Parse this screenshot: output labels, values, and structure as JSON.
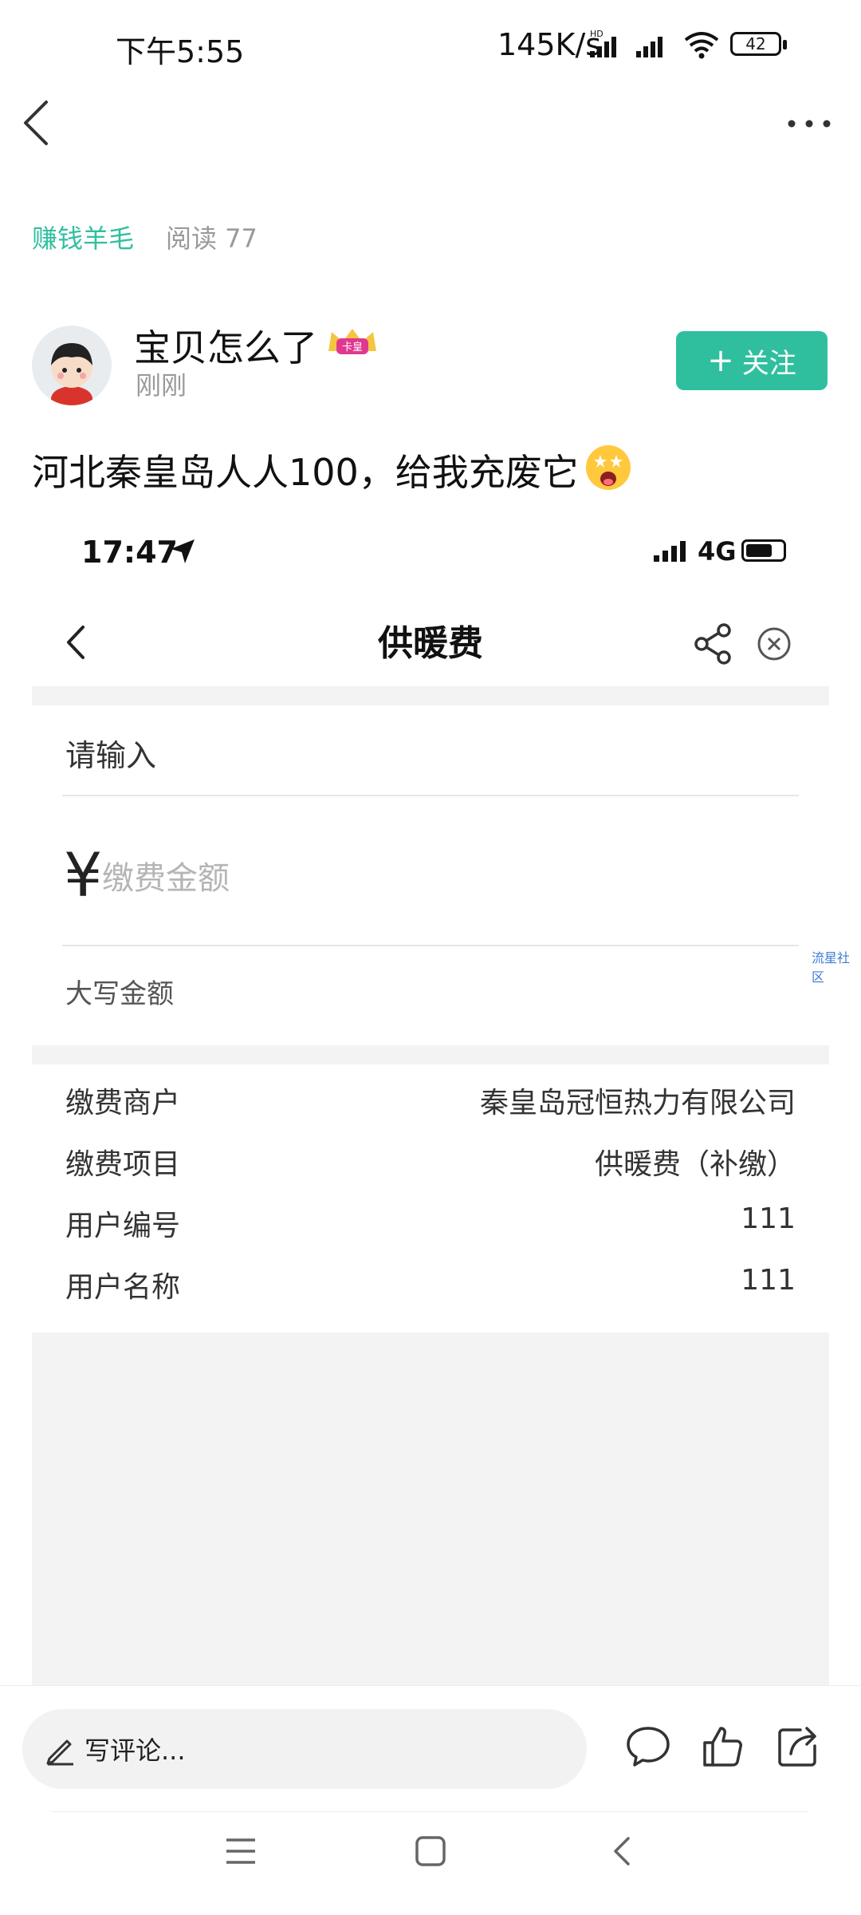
{
  "status_bar": {
    "time": "下午5:55",
    "net_speed": "145K/s",
    "battery": "42"
  },
  "header": {
    "icons": [
      "chevron-left-icon",
      "more-icon"
    ]
  },
  "tags": {
    "category": "赚钱羊毛",
    "reads": "阅读 77"
  },
  "author": {
    "name": "宝贝怎么了",
    "time": "刚刚",
    "badge": "卡皇",
    "follow_label": "关注",
    "follow_color": "#2fbf9f"
  },
  "post": {
    "text": "河北秦皇岛人人100，给我充废它"
  },
  "screenshot": {
    "time": "17:47",
    "network": "4G",
    "title": "供暖费",
    "input_placeholder": "请输入",
    "currency": "¥",
    "amount_placeholder": "缴费金额",
    "uppercase_label": "大写金额",
    "watermark": "流星社区",
    "rows": [
      {
        "label": "缴费商户",
        "value": "秦皇岛冠恒热力有限公司"
      },
      {
        "label": "缴费项目",
        "value": "供暖费（补缴）"
      },
      {
        "label": "用户编号",
        "value": "111"
      },
      {
        "label": "用户名称",
        "value": "111"
      }
    ]
  },
  "bottom": {
    "comment_placeholder": "写评论..."
  },
  "colors": {
    "accent": "#2fbf9f",
    "gray_band": "#f3f3f3"
  }
}
